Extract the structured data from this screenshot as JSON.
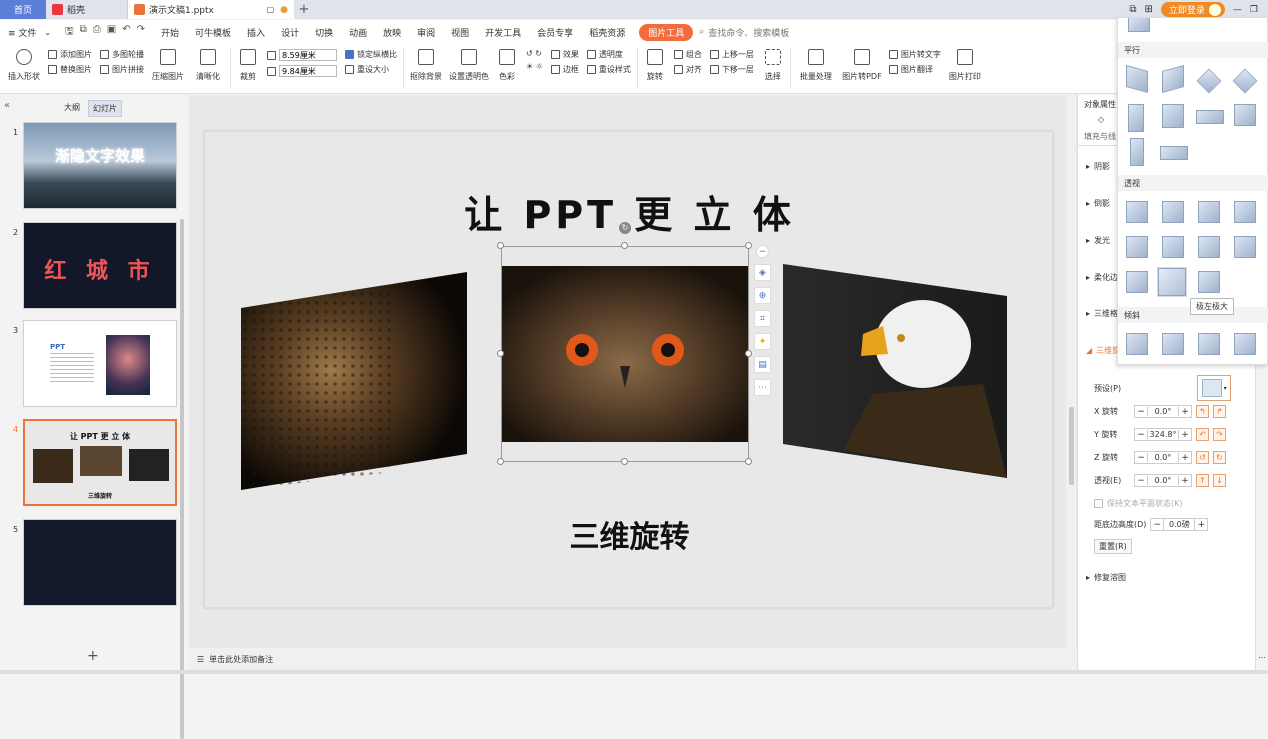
{
  "tabs": {
    "home": "首页",
    "docer": "稻壳",
    "document": "演示文稿1.pptx",
    "add": "+"
  },
  "topright": {
    "login": "立即登录"
  },
  "menu": {
    "file": "≡ 文件",
    "items": [
      "开始",
      "可牛模板",
      "插入",
      "设计",
      "切换",
      "动画",
      "放映",
      "审阅",
      "视图",
      "开发工具",
      "会员专享",
      "稻壳资源"
    ],
    "active": "图片工具",
    "search": "查找命令、搜索模板"
  },
  "ribbon": {
    "insert_shape": "插入形状",
    "add_image": "添加图片",
    "multi_outline": "多图轮播",
    "replace_image": "替换图片",
    "image_collage": "图片拼接",
    "compress": "压缩图片",
    "clarity": "清晰化",
    "crop": "裁剪",
    "width_value": "8.59厘米",
    "height_value": "9.84厘米",
    "lock_ratio": "锁定纵横比",
    "reset_size": "重设大小",
    "remove_bg": "抠除背景",
    "set_transparent": "设置透明色",
    "color": "色彩",
    "effects": "效果",
    "transparency": "透明度",
    "border": "边框",
    "reset_style": "重设样式",
    "rotate": "旋转",
    "group": "组合",
    "align": "对齐",
    "bring_forward": "上移一层",
    "send_backward": "下移一层",
    "select": "选择",
    "batch": "批量处理",
    "to_pdf": "图片转PDF",
    "to_text": "图片转文字",
    "translate": "图片翻译",
    "print": "图片打印"
  },
  "leftpanel": {
    "tab_outline": "大纲",
    "tab_slides": "幻灯片",
    "slides": [
      {
        "num": "1",
        "text": "渐隐文字效果"
      },
      {
        "num": "2",
        "text": "红 城 市"
      },
      {
        "num": "3",
        "text": "PPT"
      },
      {
        "num": "4",
        "title": "让 PPT 更 立 体",
        "subtitle": "三维旋转"
      },
      {
        "num": "5"
      }
    ]
  },
  "slide": {
    "title": "让 PPT 更 立 体",
    "subtitle": "三维旋转"
  },
  "notes": {
    "placeholder": "单击此处添加备注"
  },
  "rightpanel": {
    "header": "对象属性",
    "fill_line": "填充与线",
    "sections": [
      "阴影",
      "倒影",
      "发光",
      "柔化边",
      "三维格",
      "三维旋转"
    ],
    "preset_label": "预设(P)",
    "x_rot_label": "X 旋转",
    "x_rot_value": "0.0°",
    "y_rot_label": "Y 旋转",
    "y_rot_value": "324.8°",
    "z_rot_label": "Z 旋转",
    "z_rot_value": "0.0°",
    "persp_label": "透视(E)",
    "persp_value": "0.0°",
    "keep_flat": "保持文本平面状态(K)",
    "distance_label": "距底边高度(D)",
    "distance_value": "0.0磅",
    "reset_btn": "重置(R)",
    "repair": "修复溶图"
  },
  "dropdown": {
    "parallel": "平行",
    "perspective": "透视",
    "oblique": "倾斜",
    "tooltip": "极左极大"
  },
  "colors": {
    "accent": "#f26c3e",
    "home_tab": "#5b7fd6",
    "login": "#f08a24"
  }
}
